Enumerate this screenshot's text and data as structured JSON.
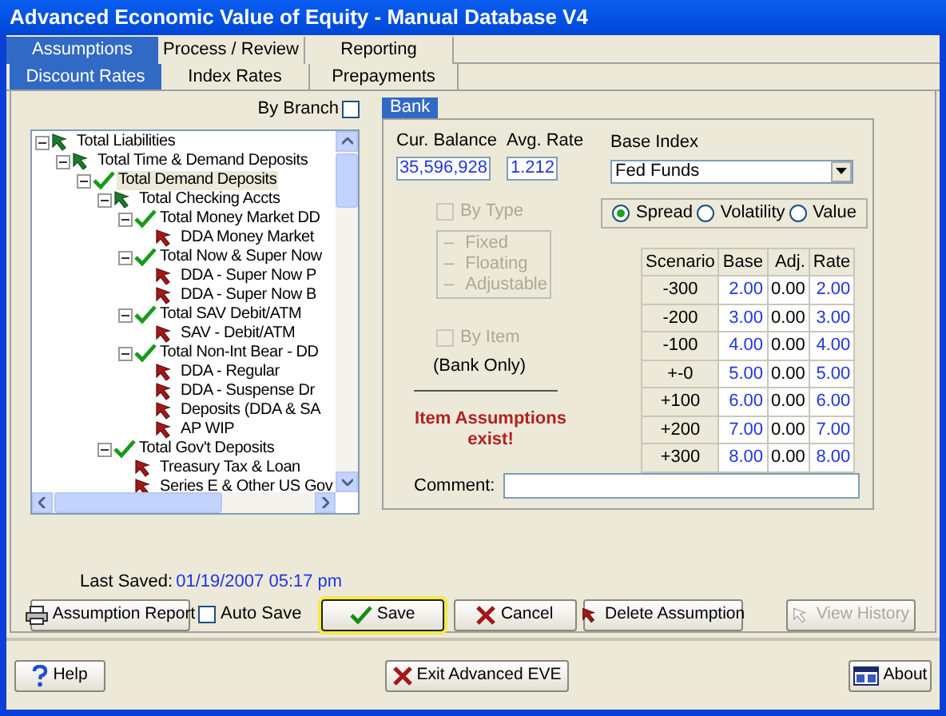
{
  "window": {
    "title": "Advanced Economic Value of Equity - Manual Database V4"
  },
  "tabs": [
    {
      "label": "Assumptions",
      "selected": true
    },
    {
      "label": "Process / Review",
      "selected": false
    },
    {
      "label": "Reporting",
      "selected": false
    }
  ],
  "subtabs": [
    {
      "label": "Discount Rates",
      "selected": true
    },
    {
      "label": "Index Rates",
      "selected": false
    },
    {
      "label": "Prepayments",
      "selected": false
    }
  ],
  "by_branch": {
    "label": "By Branch",
    "checked": false
  },
  "tree": [
    {
      "label": "Total Liabilities",
      "kind": "rollup",
      "selected": false,
      "children": [
        {
          "label": "Total Time & Demand Deposits",
          "kind": "rollup",
          "selected": false,
          "children": [
            {
              "label": "Total Demand Deposits",
              "kind": "assumed",
              "selected": true,
              "children": [
                {
                  "label": "Total Checking Accts",
                  "kind": "rollup",
                  "selected": false,
                  "children": [
                    {
                      "label": "Total Money Market DD",
                      "kind": "assumed",
                      "selected": false,
                      "children": [
                        {
                          "label": "DDA Money Market",
                          "kind": "item",
                          "selected": false
                        }
                      ]
                    },
                    {
                      "label": "Total Now & Super Now",
                      "kind": "assumed",
                      "selected": false,
                      "children": [
                        {
                          "label": "DDA - Super Now P",
                          "kind": "item",
                          "selected": false
                        },
                        {
                          "label": "DDA - Super Now B",
                          "kind": "item",
                          "selected": false
                        }
                      ]
                    },
                    {
                      "label": "Total SAV Debit/ATM",
                      "kind": "assumed",
                      "selected": false,
                      "children": [
                        {
                          "label": "SAV - Debit/ATM",
                          "kind": "item",
                          "selected": false
                        }
                      ]
                    },
                    {
                      "label": "Total Non-Int Bear - DD",
                      "kind": "assumed",
                      "selected": false,
                      "children": [
                        {
                          "label": "DDA - Regular",
                          "kind": "item",
                          "selected": false
                        },
                        {
                          "label": "DDA - Suspense Dr",
                          "kind": "item",
                          "selected": false
                        },
                        {
                          "label": "Deposits (DDA & SA",
                          "kind": "item",
                          "selected": false
                        },
                        {
                          "label": "AP WIP",
                          "kind": "item",
                          "selected": false
                        }
                      ]
                    }
                  ]
                },
                {
                  "label": "Total Gov't Deposits",
                  "kind": "assumed",
                  "selected": false,
                  "children": [
                    {
                      "label": "Treasury Tax & Loan",
                      "kind": "item",
                      "selected": false
                    },
                    {
                      "label": "Series E & Other US Gov",
                      "kind": "item",
                      "selected": false
                    }
                  ]
                }
              ]
            }
          ]
        }
      ]
    }
  ],
  "detail_tab": {
    "label": "Bank",
    "selected": true
  },
  "cur_balance": {
    "label": "Cur. Balance",
    "value": "35,596,928"
  },
  "avg_rate": {
    "label": "Avg. Rate",
    "value": "1.212"
  },
  "base_index": {
    "label": "Base Index",
    "value": "Fed Funds"
  },
  "by_type": {
    "label": "By Type",
    "checked": false,
    "disabled": true
  },
  "type_options": [
    {
      "marker": "–",
      "label": "Fixed"
    },
    {
      "marker": "–",
      "label": "Floating"
    },
    {
      "marker": "–",
      "label": "Adjustable"
    }
  ],
  "by_item": {
    "label": "By Item",
    "checked": false,
    "disabled": true
  },
  "bank_only": "(Bank Only)",
  "warning": "Item Assumptions exist!",
  "modes": [
    {
      "label": "Spread",
      "selected": true
    },
    {
      "label": "Volatility",
      "selected": false
    },
    {
      "label": "Value",
      "selected": false
    }
  ],
  "scenario_table": {
    "columns": [
      "Scenario",
      "Base",
      "Adj.",
      "Rate"
    ],
    "rows": [
      [
        "-300",
        "2.00",
        "0.00",
        "2.00"
      ],
      [
        "-200",
        "3.00",
        "0.00",
        "3.00"
      ],
      [
        "-100",
        "4.00",
        "0.00",
        "4.00"
      ],
      [
        "+-0",
        "5.00",
        "0.00",
        "5.00"
      ],
      [
        "+100",
        "6.00",
        "0.00",
        "6.00"
      ],
      [
        "+200",
        "7.00",
        "0.00",
        "7.00"
      ],
      [
        "+300",
        "8.00",
        "0.00",
        "8.00"
      ]
    ]
  },
  "comment": {
    "label": "Comment:"
  },
  "last_saved": {
    "label": "Last Saved:",
    "value": "01/19/2007 05:17 pm"
  },
  "auto_save": {
    "label": "Auto Save",
    "checked": false
  },
  "actions": [
    {
      "label": "Assumption Report",
      "kind": "report",
      "disabled": false,
      "focused": false
    },
    {
      "label": "Save",
      "kind": "save",
      "disabled": false,
      "focused": true
    },
    {
      "label": "Cancel",
      "kind": "cancel",
      "disabled": false,
      "focused": false
    },
    {
      "label": "Delete Assumption",
      "kind": "delete",
      "disabled": false,
      "focused": false
    },
    {
      "label": "View History",
      "kind": "history",
      "disabled": true,
      "focused": false
    }
  ],
  "footer": [
    {
      "label": "Help",
      "kind": "help"
    },
    {
      "label": "Exit Advanced EVE",
      "kind": "exit"
    },
    {
      "label": "About",
      "kind": "about"
    }
  ]
}
